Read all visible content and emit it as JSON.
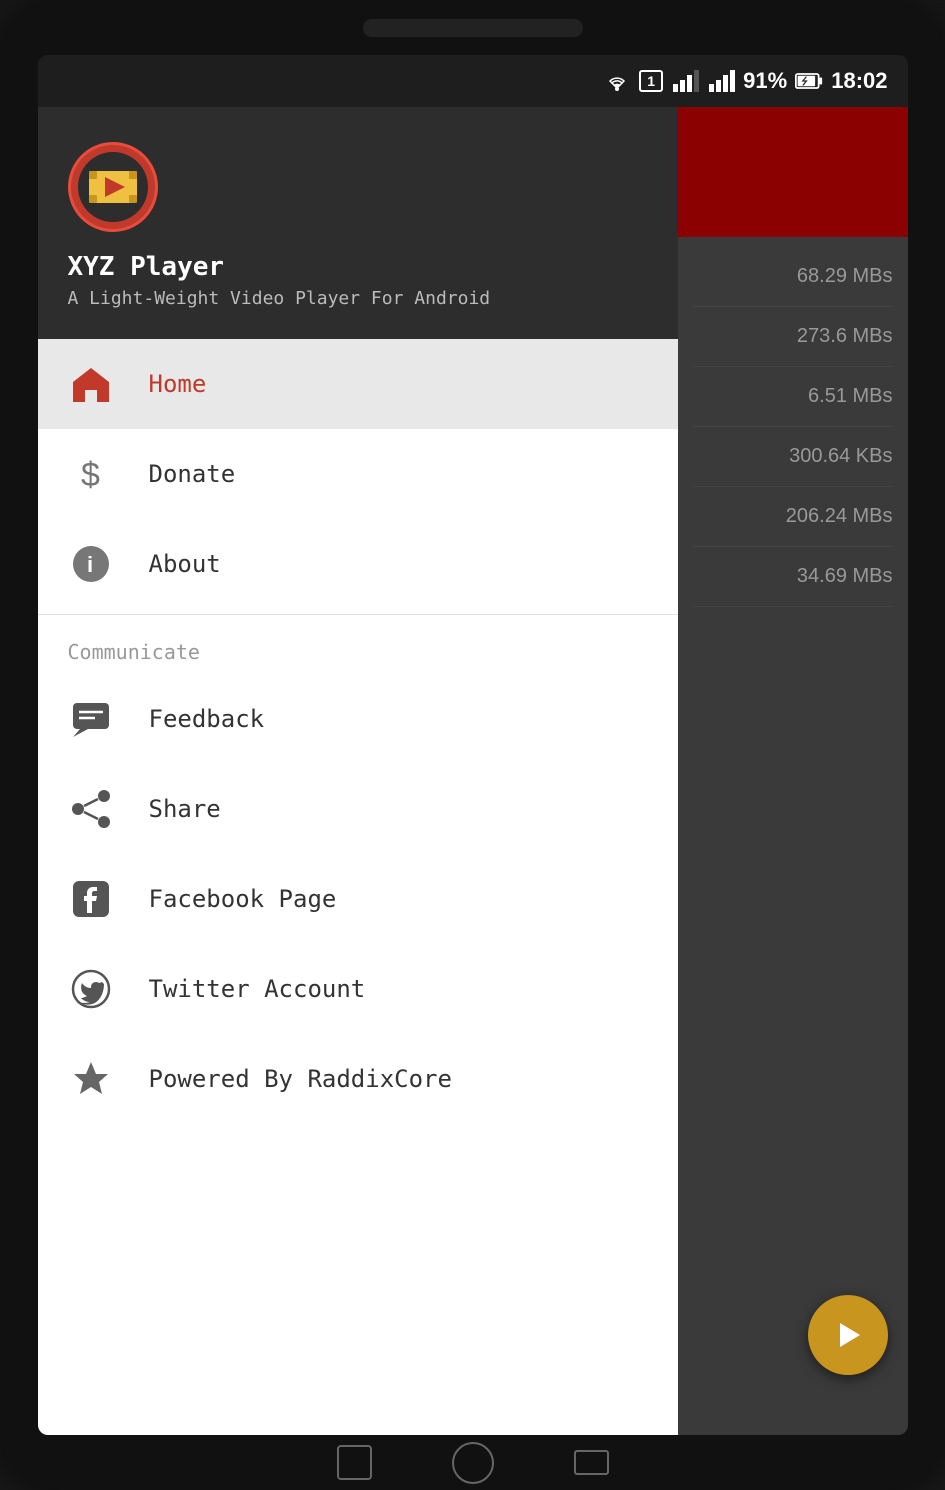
{
  "statusBar": {
    "time": "18:02",
    "battery": "91%",
    "icons": [
      "wifi",
      "sim",
      "signal1",
      "signal2",
      "battery"
    ]
  },
  "app": {
    "name": "XYZ Player",
    "subtitle": "A Light-Weight Video Player For Android",
    "logoAlt": "XYZ Player Logo"
  },
  "drawer": {
    "navItems": [
      {
        "id": "home",
        "label": "Home",
        "icon": "home",
        "active": true
      },
      {
        "id": "donate",
        "label": "Donate",
        "icon": "dollar",
        "active": false
      },
      {
        "id": "about",
        "label": "About",
        "icon": "info",
        "active": false
      }
    ],
    "communicateSection": {
      "header": "Communicate",
      "items": [
        {
          "id": "feedback",
          "label": "Feedback",
          "icon": "feedback"
        },
        {
          "id": "share",
          "label": "Share",
          "icon": "share"
        },
        {
          "id": "facebook",
          "label": "Facebook Page",
          "icon": "facebook"
        },
        {
          "id": "twitter",
          "label": "Twitter Account",
          "icon": "twitter"
        },
        {
          "id": "powered",
          "label": "Powered By RaddixCore",
          "icon": "star"
        }
      ]
    }
  },
  "bgContent": {
    "sizes": [
      "68.29 MBs",
      "273.6 MBs",
      "6.51 MBs",
      "300.64 KBs",
      "206.24 MBs",
      "34.69 MBs"
    ]
  }
}
